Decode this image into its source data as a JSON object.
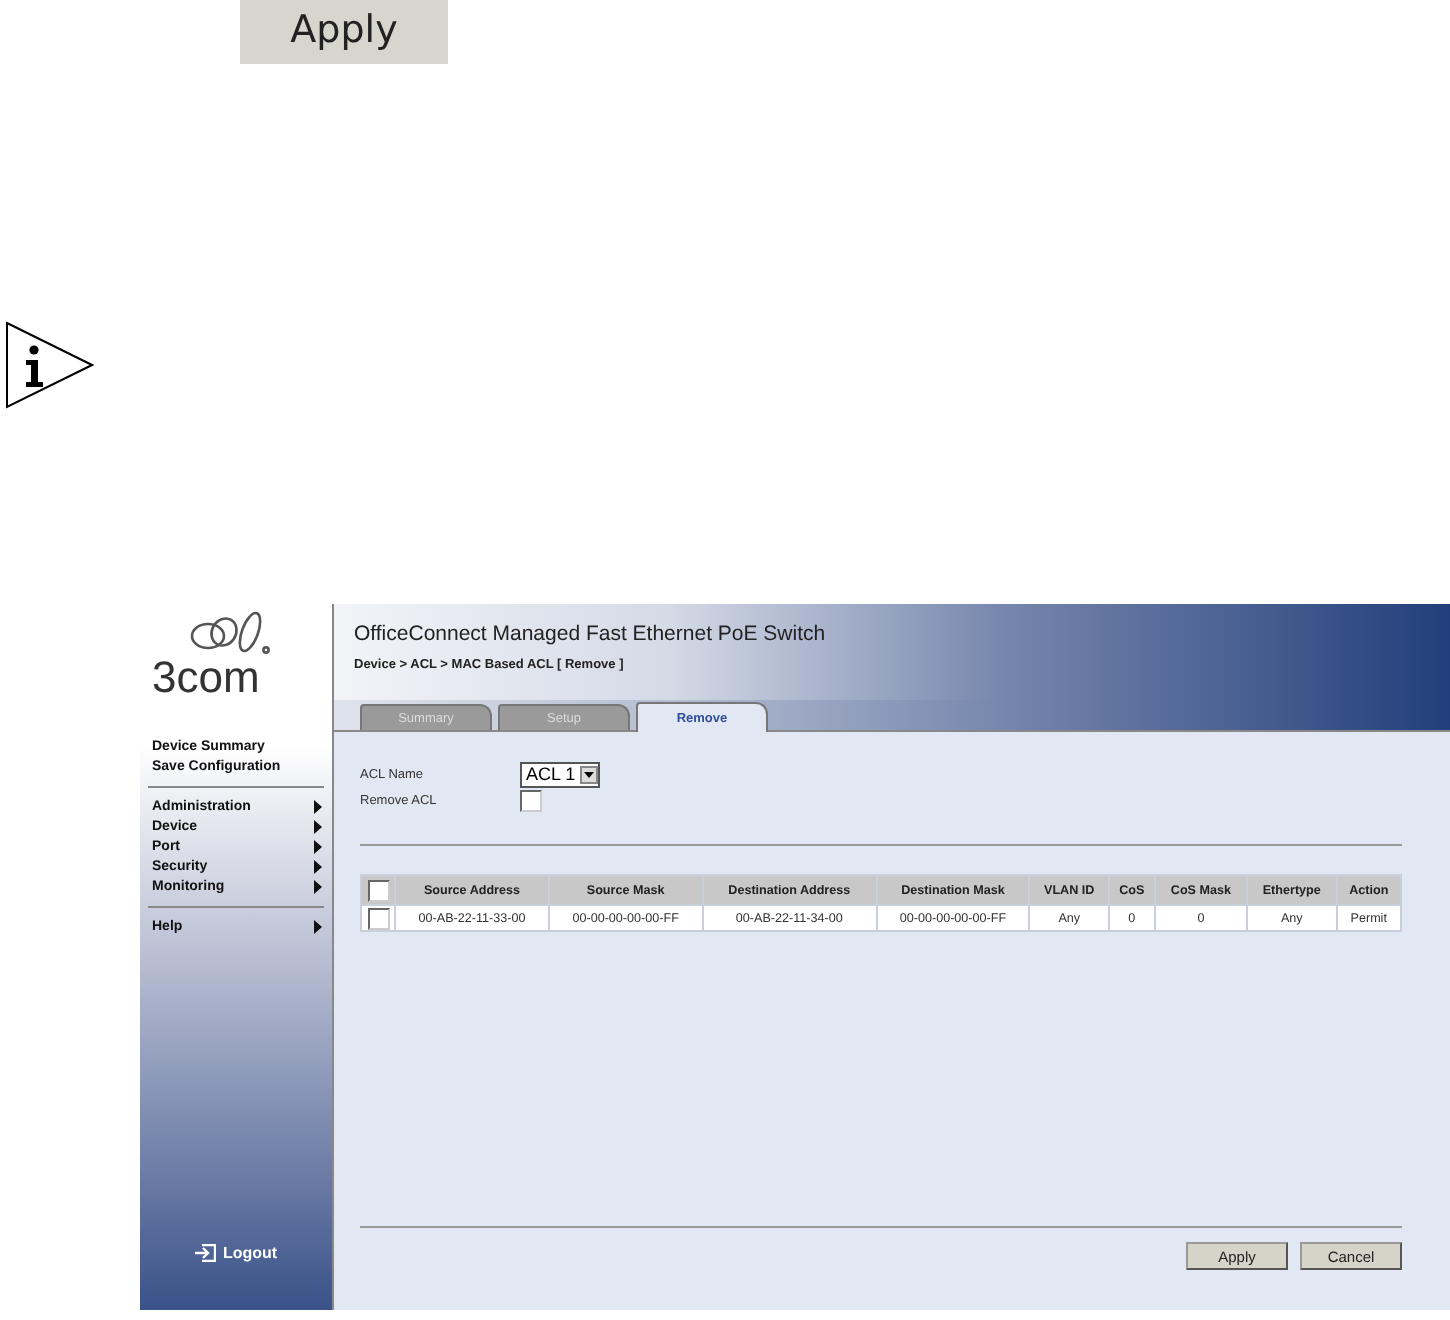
{
  "doc_button": {
    "label": "Apply"
  },
  "app": {
    "logo": "3com",
    "title": "OfficeConnect Managed Fast Ethernet PoE Switch",
    "breadcrumb": "Device > ACL > MAC Based ACL [ Remove ]",
    "sidebar": {
      "links": [
        "Device Summary",
        "Save Configuration"
      ],
      "menus": [
        {
          "label": "Administration"
        },
        {
          "label": "Device"
        },
        {
          "label": "Port"
        },
        {
          "label": "Security"
        },
        {
          "label": "Monitoring"
        }
      ],
      "help_menus": [
        {
          "label": "Help"
        }
      ],
      "logout": "Logout"
    },
    "tabs": [
      {
        "label": "Summary",
        "selected": false
      },
      {
        "label": "Setup",
        "selected": false
      },
      {
        "label": "Remove",
        "selected": true
      }
    ],
    "form": {
      "acl_name": {
        "label": "ACL Name",
        "value": "ACL 1"
      },
      "remove_acl": {
        "label": "Remove ACL",
        "checked": false
      }
    },
    "table": {
      "select_all_checked": false,
      "columns": [
        "Source Address",
        "Source Mask",
        "Destination Address",
        "Destination Mask",
        "VLAN ID",
        "CoS",
        "CoS Mask",
        "Ethertype",
        "Action"
      ],
      "rows": [
        {
          "checked": false,
          "cells": [
            "00-AB-22-11-33-00",
            "00-00-00-00-00-FF",
            "00-AB-22-11-34-00",
            "00-00-00-00-00-FF",
            "Any",
            "0",
            "0",
            "Any",
            "Permit"
          ]
        }
      ]
    },
    "buttons": [
      "Apply",
      "Cancel"
    ]
  }
}
